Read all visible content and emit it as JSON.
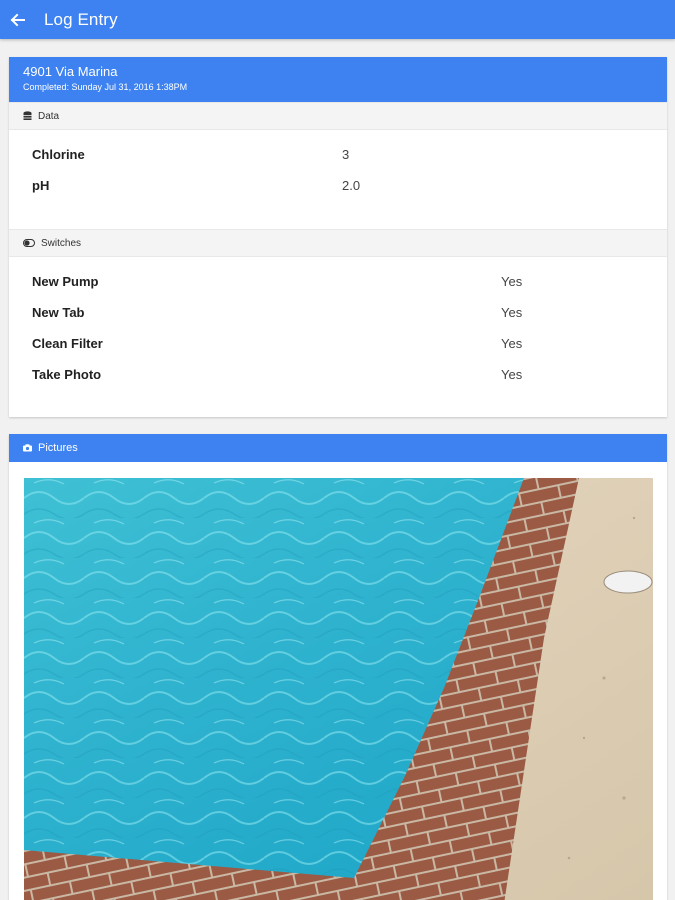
{
  "header": {
    "title": "Log Entry",
    "back_icon": "arrow-left-icon"
  },
  "entry": {
    "address": "4901 Via Marina",
    "completed": "Completed: Sunday Jul 31, 2016 1:38PM"
  },
  "data_section": {
    "title": "Data",
    "icon": "database-icon",
    "rows": [
      {
        "label": "Chlorine",
        "value": "3"
      },
      {
        "label": "pH",
        "value": "2.0"
      }
    ]
  },
  "switches_section": {
    "title": "Switches",
    "icon": "toggle-icon",
    "rows": [
      {
        "label": "New Pump",
        "value": "Yes"
      },
      {
        "label": "New Tab",
        "value": "Yes"
      },
      {
        "label": "Clean Filter",
        "value": "Yes"
      },
      {
        "label": "Take Photo",
        "value": "Yes"
      }
    ]
  },
  "pictures_section": {
    "title": "Pictures",
    "icon": "camera-icon"
  },
  "colors": {
    "primary": "#3d82f0",
    "background": "#f1f1f1",
    "section_bar": "#f4f4f4"
  }
}
